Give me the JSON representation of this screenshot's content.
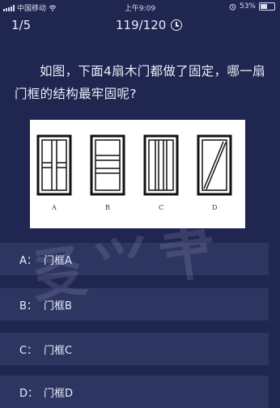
{
  "status_bar": {
    "carrier": "中国移动",
    "time": "上午9:09",
    "battery": "53%",
    "icons": [
      "signal-icon",
      "wifi-icon",
      "alarm-icon",
      "battery-icon"
    ]
  },
  "header": {
    "progress": "1/5",
    "timer": "119/120"
  },
  "question": {
    "text": "如图，下面4扇木门都做了固定，哪一扇门框的结构最牢固呢?"
  },
  "figure": {
    "labels": [
      "A",
      "B",
      "C",
      "D"
    ]
  },
  "options": [
    {
      "letter": "A：",
      "text": "门框A"
    },
    {
      "letter": "B：",
      "text": "门框B"
    },
    {
      "letter": "C：",
      "text": "门框C"
    },
    {
      "letter": "D：",
      "text": "门框D"
    }
  ],
  "colors": {
    "background": "#1f2650",
    "option_background": "#2d3561",
    "text": "#e9ecf8"
  }
}
